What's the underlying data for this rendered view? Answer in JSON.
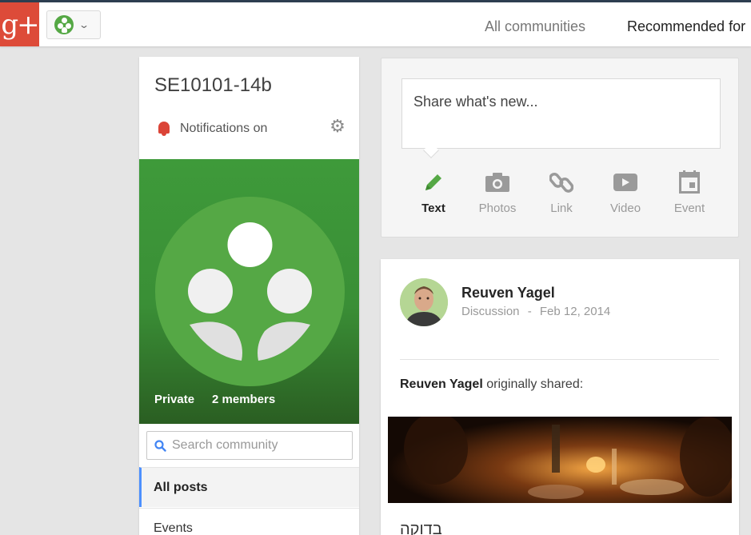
{
  "topbar": {
    "logo_text": "g+",
    "nav_all": "All communities",
    "nav_recommended": "Recommended for"
  },
  "community": {
    "title": "SE10101-14b",
    "notifications": "Notifications on",
    "privacy": "Private",
    "members": "2 members",
    "search_placeholder": "Search community",
    "menu": {
      "all_posts": "All posts",
      "events": "Events"
    }
  },
  "share": {
    "prompt": "Share what's new...",
    "options": {
      "text": "Text",
      "photos": "Photos",
      "link": "Link",
      "video": "Video",
      "event": "Event"
    }
  },
  "post": {
    "author": "Reuven Yagel",
    "category": "Discussion",
    "separator": "-",
    "date": "Feb 12, 2014",
    "shared_by": "Reuven Yagel",
    "shared_suffix": " originally shared:",
    "body_text": "בדוקה"
  },
  "colors": {
    "brand_red": "#dd4b39",
    "community_green": "#55a845",
    "active_accent": "#4d90fe",
    "bell_red": "#db4437"
  },
  "icons": [
    "google-plus-logo",
    "community-icon",
    "chevron-down-icon",
    "bell-icon",
    "gear-icon",
    "search-icon",
    "pencil-icon",
    "camera-icon",
    "link-icon",
    "video-icon",
    "calendar-icon"
  ]
}
